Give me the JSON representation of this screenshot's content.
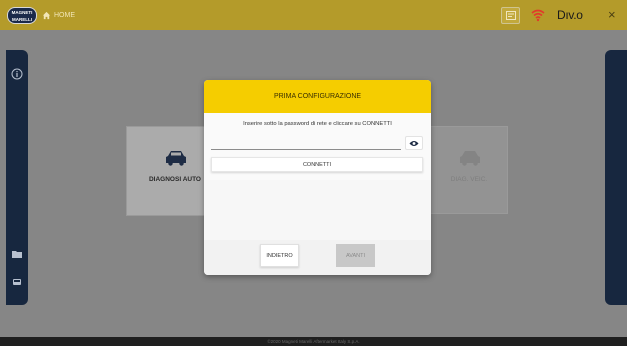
{
  "topbar": {
    "logo_text": "MAGNETI MARELLI",
    "home_label": "HOME",
    "brand": "Dıv.o",
    "close_symbol": "×",
    "icons": [
      "home-icon",
      "card-reader-icon",
      "wifi-icon",
      "close-icon"
    ]
  },
  "sidebar_left": {
    "icons": [
      "info-icon",
      "folder-icon",
      "car-front-icon"
    ]
  },
  "tiles": [
    {
      "label": "DIAGNOSI AUTO",
      "icon": "car-icon"
    },
    {
      "label": "DIAG. VEIC.",
      "icon": "car-icon"
    }
  ],
  "footer": {
    "text": "©2020 Magneti Marelli Aftermarket Italy S.p.A."
  },
  "dialog": {
    "title": "PRIMA CONFIGURAZIONE",
    "instruction": "Inserire sotto la password di rete e cliccare su CONNETTI",
    "password_value": "",
    "password_placeholder": "",
    "connect_label": "CONNETTI",
    "back_label": "INDIETRO",
    "next_label": "AVANTI"
  },
  "colors": {
    "topbar": "#b49b2a",
    "dialog_header": "#f5cd00",
    "sidebar": "#17273f",
    "wifi": "#e23a2a"
  }
}
